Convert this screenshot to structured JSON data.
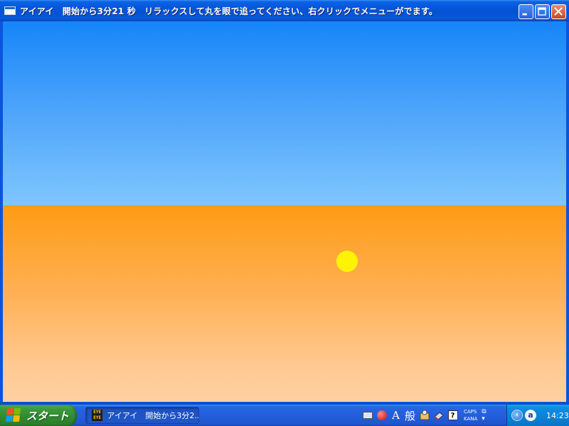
{
  "window": {
    "title": "アイアイ　開始から3分21 秒　リラックスして丸を眼で追ってください、右クリックでメニューがでます。",
    "buttons": {
      "minimize": "minimize",
      "maximize": "maximize",
      "close": "close"
    }
  },
  "scene": {
    "sky_color_top": "#1585f8",
    "sky_color_bottom": "#7fc6fe",
    "ground_color_top": "#ff9b14",
    "ground_color_bottom": "#ffcfa3",
    "ball_color": "#fff400"
  },
  "taskbar": {
    "start_label": "スタート",
    "task_button_label": "アイアイ　開始から3分2...",
    "task_icon_text": "EYE EYE",
    "lang_bar": {
      "ime_char_a": "A",
      "ime_mode": "般",
      "help": "?",
      "caps": "CAPS",
      "kana": "KANA"
    },
    "tray_ime_label": "a",
    "clock": "14:23"
  }
}
